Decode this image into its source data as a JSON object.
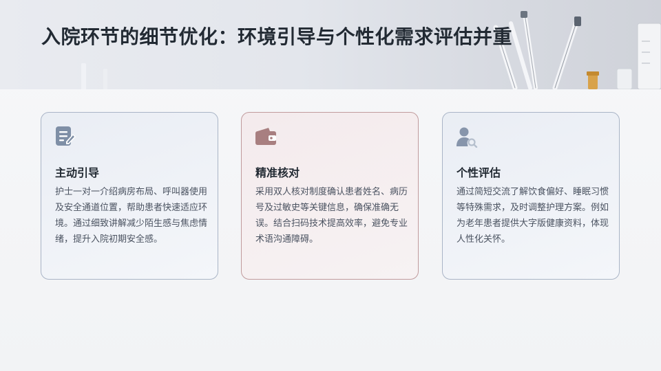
{
  "page": {
    "title": "入院环节的细节优化：环境引导与个性化需求评估并重"
  },
  "cards": [
    {
      "icon": "document-edit-icon",
      "title": "主动引导",
      "body": "护士一对一介绍病房布局、呼叫器使用及安全通道位置，帮助患者快速适应环境。通过细致讲解减少陌生感与焦虑情绪，提升入院初期安全感。",
      "accent": "#7f8fa6"
    },
    {
      "icon": "wallet-icon",
      "title": "精准核对",
      "body": "采用双人核对制度确认患者姓名、病历号及过敏史等关键信息，确保准确无误。结合扫码技术提高效率，避免专业术语沟通障碍。",
      "accent": "#a87f80"
    },
    {
      "icon": "user-search-icon",
      "title": "个性评估",
      "body": "通过简短交流了解饮食偏好、睡眠习惯等特殊需求，及时调整护理方案。例如为老年患者提供大字版健康资料，体现人性化关怀。",
      "accent": "#8795ab"
    }
  ]
}
